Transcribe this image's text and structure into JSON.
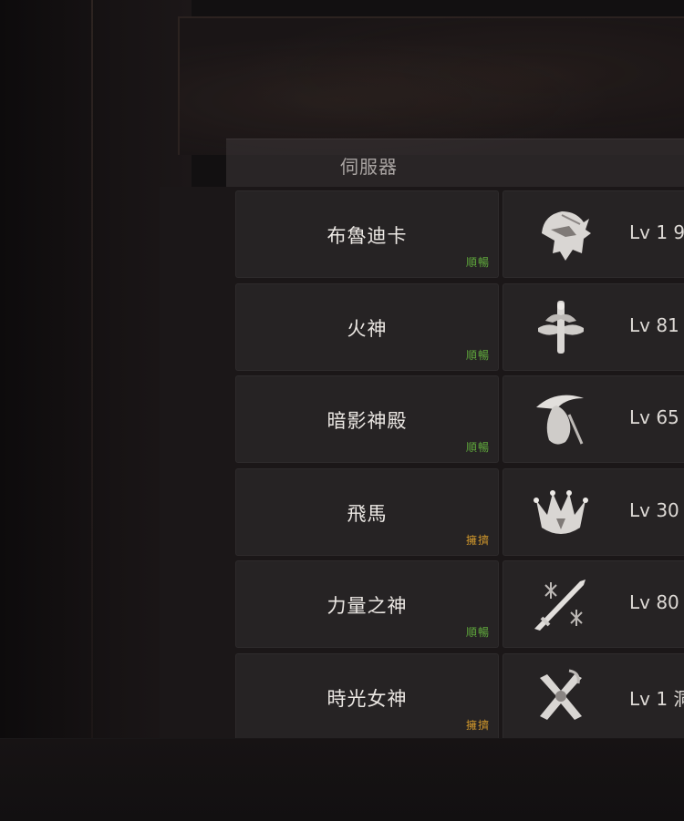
{
  "header": {
    "server_label": "伺服器"
  },
  "status_colors": {
    "smooth": "#5fa83c",
    "crowded": "#d49a2c"
  },
  "rows": [
    {
      "server": "布魯迪卡",
      "status": "順暢",
      "status_type": "smooth",
      "class_icon": "gunslinger-helmet-icon",
      "level": "Lv 1 9"
    },
    {
      "server": "火神",
      "status": "順暢",
      "status_type": "smooth",
      "class_icon": "sword-emblem-icon",
      "level": "Lv 81"
    },
    {
      "server": "暗影神殿",
      "status": "順暢",
      "status_type": "smooth",
      "class_icon": "scythe-reaper-icon",
      "level": "Lv 65"
    },
    {
      "server": "飛馬",
      "status": "擁擠",
      "status_type": "crowded",
      "class_icon": "crown-icon",
      "level": "Lv 30"
    },
    {
      "server": "力量之神",
      "status": "順暢",
      "status_type": "smooth",
      "class_icon": "blade-snowflake-icon",
      "level": "Lv 80"
    },
    {
      "server": "時光女神",
      "status": "擁擠",
      "status_type": "crowded",
      "class_icon": "ribbon-emblem-icon",
      "level": "Lv 1 洞"
    }
  ]
}
